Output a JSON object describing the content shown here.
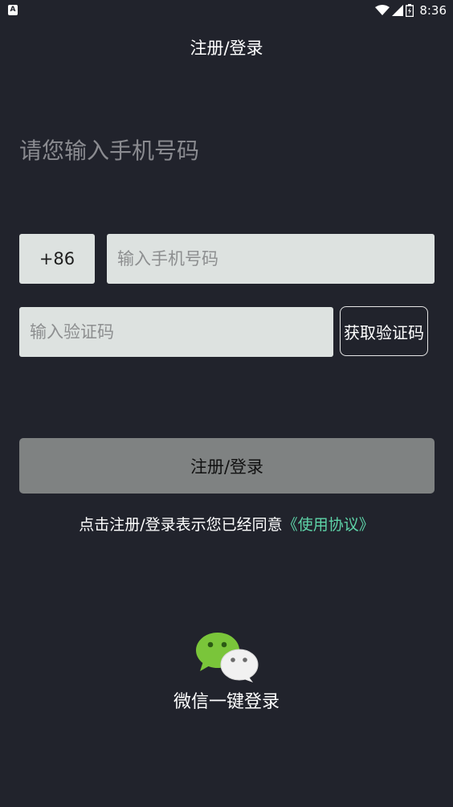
{
  "status_bar": {
    "left_icon": "A",
    "time": "8:36",
    "icons": [
      "wifi-icon",
      "signal-icon",
      "battery-icon"
    ]
  },
  "header": {
    "title": "注册/登录"
  },
  "prompt": "请您输入手机号码",
  "phone": {
    "country_code": "+86",
    "placeholder": "输入手机号码",
    "value": ""
  },
  "verification": {
    "placeholder": "输入验证码",
    "value": "",
    "get_code_label": "获取验证码"
  },
  "submit": {
    "label": "注册/登录"
  },
  "agreement": {
    "text": "点击注册/登录表示您已经同意",
    "link": "《使用协议》"
  },
  "wechat_login": {
    "label": "微信一键登录",
    "icon": "wechat-icon"
  },
  "colors": {
    "background": "#21232c",
    "input_bg": "#dde2e0",
    "button_bg": "#7f8282",
    "link": "#5ed3a8",
    "wechat_green": "#7ac53a"
  }
}
